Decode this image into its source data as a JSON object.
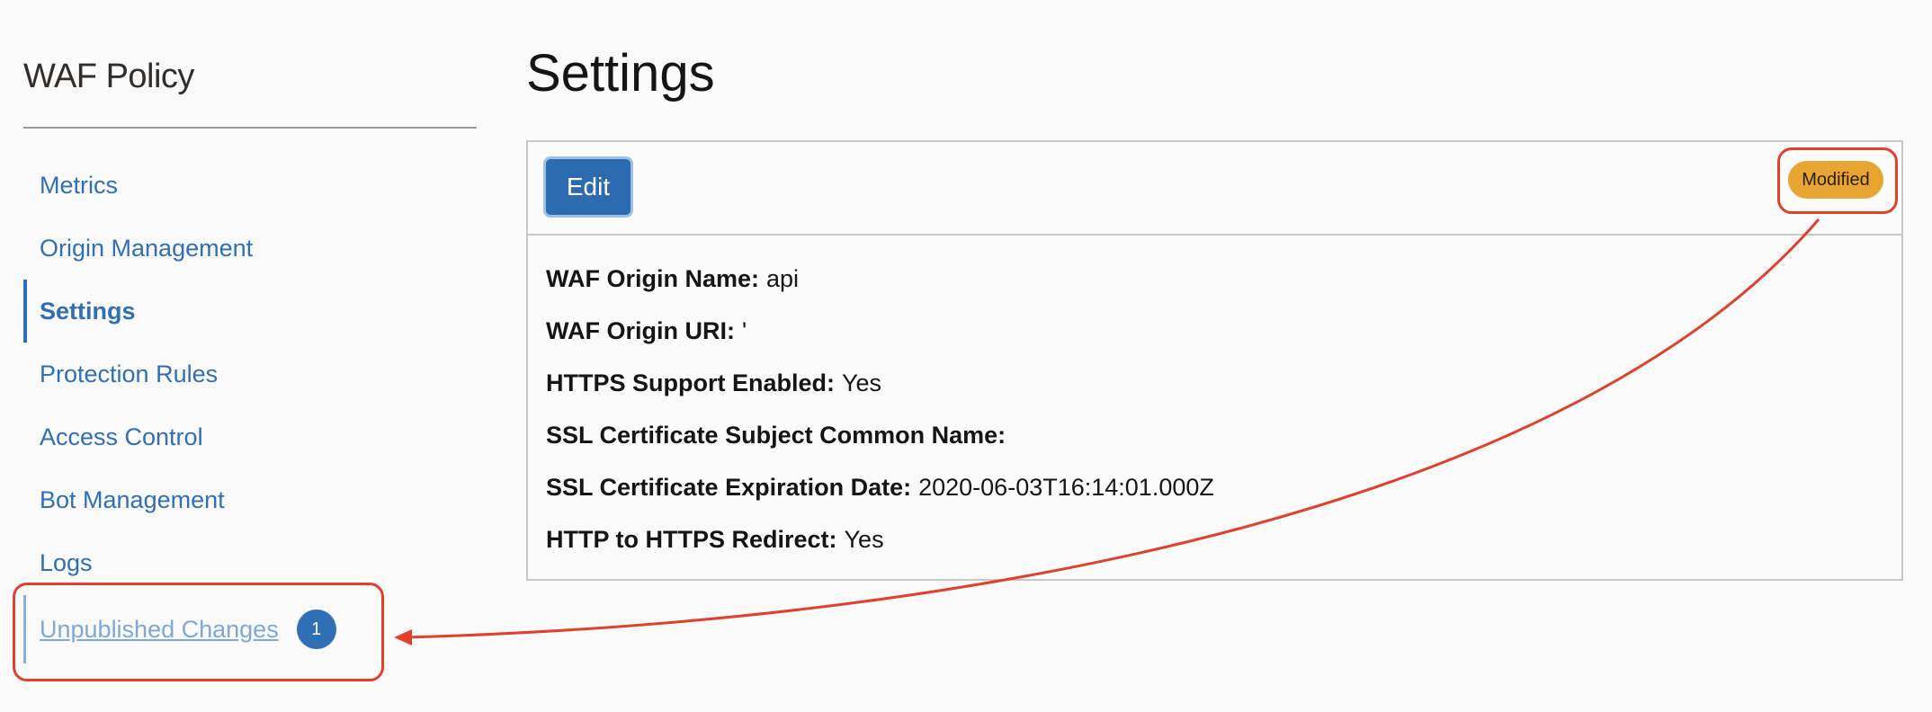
{
  "sidebar": {
    "title": "WAF Policy",
    "items": [
      {
        "label": "Metrics"
      },
      {
        "label": "Origin Management"
      },
      {
        "label": "Settings"
      },
      {
        "label": "Protection Rules"
      },
      {
        "label": "Access Control"
      },
      {
        "label": "Bot Management"
      },
      {
        "label": "Logs"
      },
      {
        "label": "Unpublished Changes",
        "count": "1"
      }
    ]
  },
  "main": {
    "title": "Settings",
    "edit_label": "Edit",
    "status_badge": "Modified",
    "details": [
      {
        "key": "WAF Origin Name:",
        "value": "api"
      },
      {
        "key": "WAF Origin URI:",
        "value": "'"
      },
      {
        "key": "HTTPS Support Enabled:",
        "value": "Yes"
      },
      {
        "key": "SSL Certificate Subject Common Name:",
        "value": ""
      },
      {
        "key": "SSL Certificate Expiration Date:",
        "value": "2020-06-03T16:14:01.000Z"
      },
      {
        "key": "HTTP to HTTPS Redirect:",
        "value": "Yes"
      }
    ]
  },
  "colors": {
    "accent": "#2f6fb6",
    "badge": "#e8a532",
    "annotation": "#e0412e"
  }
}
